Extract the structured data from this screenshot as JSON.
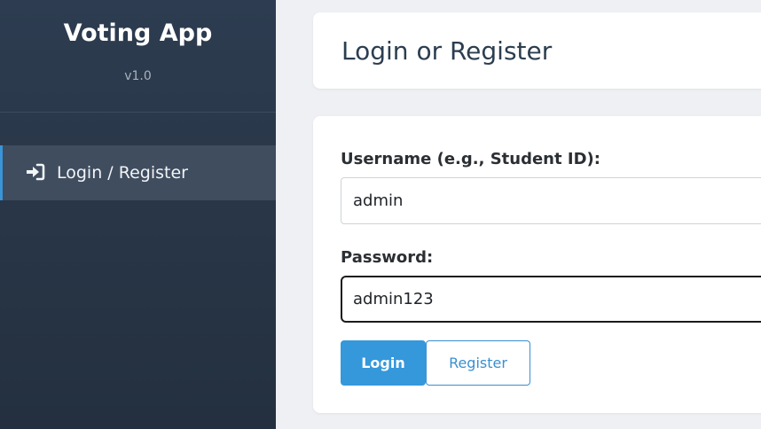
{
  "sidebar": {
    "app_title": "Voting App",
    "version": "v1.0",
    "nav": [
      {
        "label": "Login / Register",
        "icon": "sign-in-icon",
        "active": true
      }
    ]
  },
  "header": {
    "title": "Login or Register"
  },
  "form": {
    "username_label": "Username (e.g., Student ID):",
    "username_value": "admin",
    "password_label": "Password:",
    "password_value": "admin123",
    "login_label": "Login",
    "register_label": "Register"
  },
  "colors": {
    "sidebar_bg": "#2d3c50",
    "active_item_bg": "#3f4d5f",
    "accent": "#3498db",
    "page_bg": "#eef0f3",
    "title_text": "#2c3e50"
  }
}
